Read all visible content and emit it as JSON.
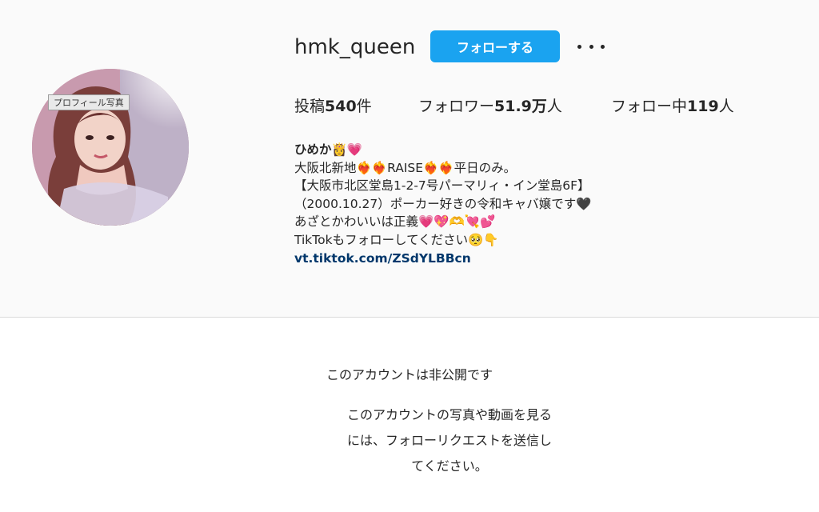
{
  "profile": {
    "username": "hmk_queen",
    "follow_label": "フォローする",
    "more_label": "•••",
    "avatar_tooltip": "プロフィール写真"
  },
  "stats": {
    "posts_prefix": "投稿",
    "posts_value": "540",
    "posts_suffix": "件",
    "followers_prefix": "フォロワー",
    "followers_value": "51.9万",
    "followers_suffix": "人",
    "following_prefix": "フォロー中",
    "following_value": "119",
    "following_suffix": "人"
  },
  "bio": {
    "name": "ひめか👸💗",
    "lines": [
      "大阪北新地❤️‍🔥❤️‍🔥RAISE❤️‍🔥❤️‍🔥平日のみ。",
      "【大阪市北区堂島1-2-7号パーマリィ・イン堂島6F】",
      "（2000.10.27）ポーカー好きの令和キャバ嬢です🖤",
      "あざとかわいいは正義💗💖🫶💘💕",
      "TikTokもフォローしてください🥺👇"
    ],
    "link": "vt.tiktok.com/ZSdYLBBcn"
  },
  "private_notice": {
    "title": "このアカウントは非公開です",
    "desc_lines": [
      "このアカウントの写真や動画を見る",
      "には、フォローリクエストを送信し",
      "てください。"
    ]
  },
  "colors": {
    "accent": "#1aa3f0",
    "link": "#00376b",
    "header_bg": "#fafafa"
  }
}
